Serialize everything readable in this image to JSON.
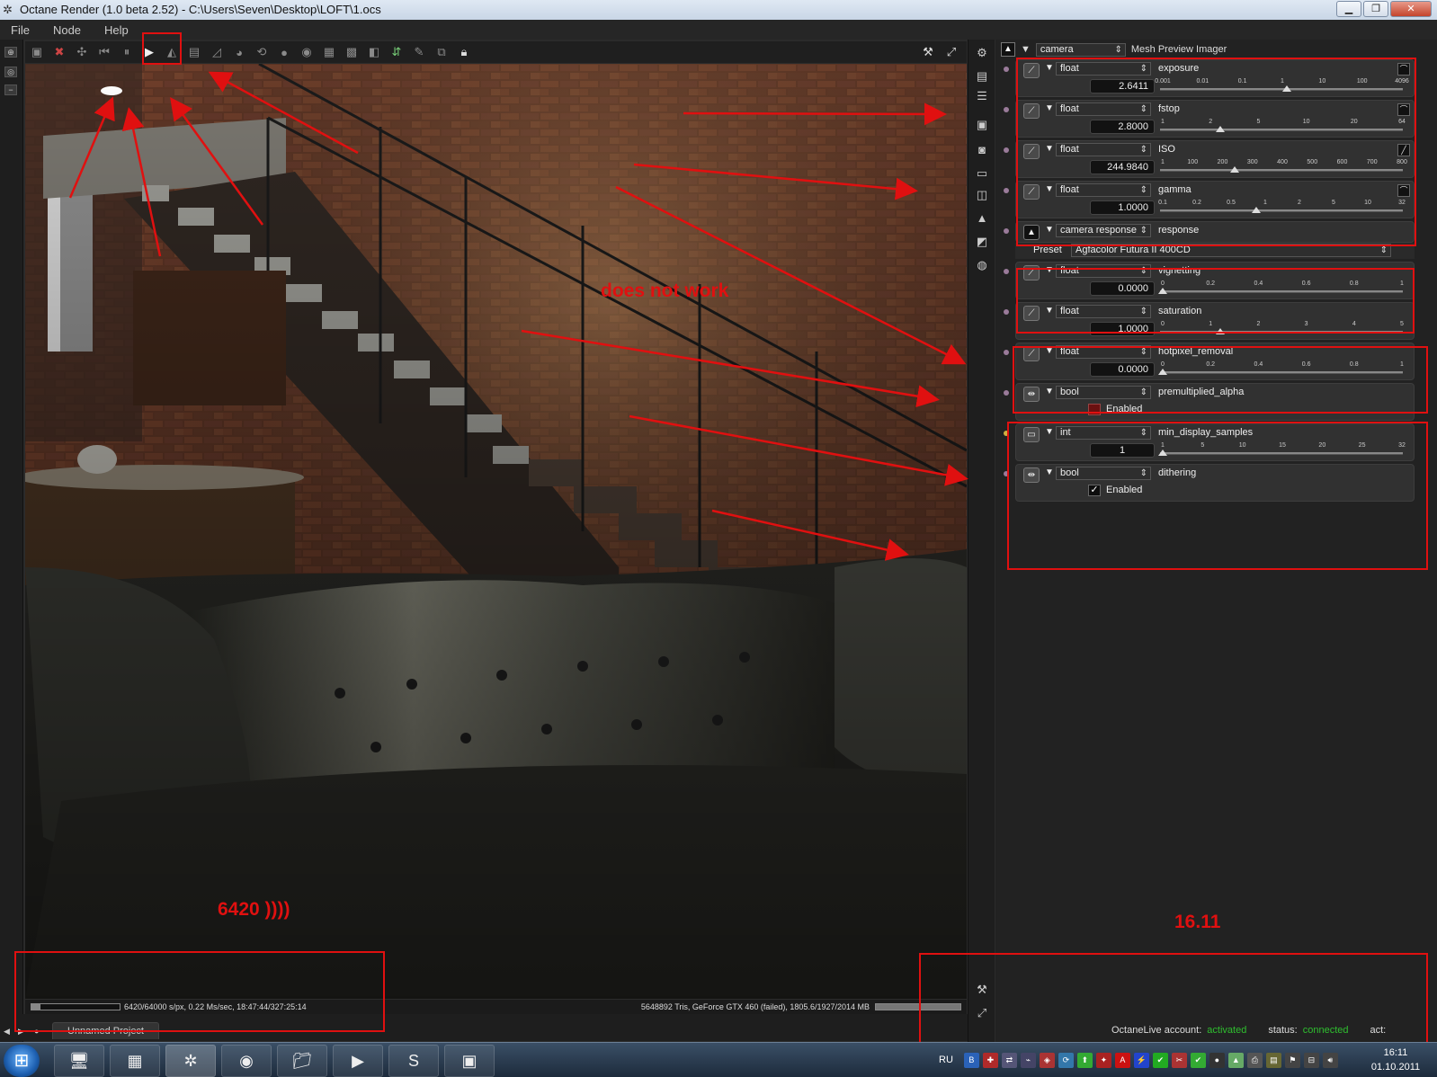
{
  "window": {
    "title": "Octane Render (1.0 beta 2.52) - C:\\Users\\Seven\\Desktop\\LOFT\\1.ocs",
    "minimize": "▁",
    "maximize": "❐",
    "close": "✕"
  },
  "menu": [
    "File",
    "Node",
    "Help"
  ],
  "status": {
    "samples": "6420/64000 s/px, 0.22 Ms/sec, 18:47:44/327:25:14",
    "progress": 0.1,
    "gpu": "5648892 Tris, GeForce GTX 460 (failed), 1805.6/1927/2014 MB"
  },
  "project_tab": "Unnamed Project",
  "panel": {
    "node_type": "camera",
    "node_name": "Mesh Preview Imager",
    "params": [
      {
        "type": "float",
        "name": "exposure",
        "value": "2.6411",
        "ticks": [
          "0.001",
          "0.01",
          "0.1",
          "1",
          "10",
          "100",
          "4096"
        ],
        "knob": 0.52
      },
      {
        "type": "float",
        "name": "fstop",
        "value": "2.8000",
        "ticks": [
          "1",
          "2",
          "5",
          "10",
          "20",
          "64"
        ],
        "knob": 0.24
      },
      {
        "type": "float",
        "name": "ISO",
        "value": "244.9840",
        "ticks": [
          "1",
          "100",
          "200",
          "300",
          "400",
          "500",
          "600",
          "700",
          "800"
        ],
        "knob": 0.3
      },
      {
        "type": "float",
        "name": "gamma",
        "value": "1.0000",
        "ticks": [
          "0.1",
          "0.2",
          "0.5",
          "1",
          "2",
          "5",
          "10",
          "32"
        ],
        "knob": 0.39
      },
      {
        "type": "camera response",
        "name": "response",
        "preset_label": "Preset",
        "preset": "Agfacolor Futura II 400CD"
      },
      {
        "type": "float",
        "name": "vignetting",
        "value": "0.0000",
        "ticks": [
          "0",
          "0.2",
          "0.4",
          "0.6",
          "0.8",
          "1"
        ],
        "knob": 0.0
      },
      {
        "type": "float",
        "name": "saturation",
        "value": "1.0000",
        "ticks": [
          "0",
          "1",
          "2",
          "3",
          "4",
          "5"
        ],
        "knob": 0.24
      },
      {
        "type": "float",
        "name": "hotpixel_removal",
        "value": "0.0000",
        "ticks": [
          "0",
          "0.2",
          "0.4",
          "0.6",
          "0.8",
          "1"
        ],
        "knob": 0.0
      },
      {
        "type": "bool",
        "name": "premultiplied_alpha",
        "checkbox_label": "Enabled",
        "checked": false
      },
      {
        "type": "int",
        "name": "min_display_samples",
        "value": "1",
        "ticks": [
          "1",
          "5",
          "10",
          "15",
          "20",
          "25",
          "32"
        ],
        "knob": 0.0
      },
      {
        "type": "bool",
        "name": "dithering",
        "checkbox_label": "Enabled",
        "checked": true
      }
    ]
  },
  "annotations": {
    "does_not_work": "does not work",
    "samples_note": "6420 ))))",
    "version_note": "16.11"
  },
  "octanelive": {
    "account_label": "OctaneLive account:",
    "account_value": "activated",
    "status_label": "status:",
    "status_value": "connected",
    "act_label": "act:"
  },
  "taskbar": {
    "lang": "RU",
    "time": "16:11",
    "date": "01.10.2011"
  },
  "colors": {
    "annotation": "#e01010",
    "accent_green": "#2fbf2f"
  }
}
